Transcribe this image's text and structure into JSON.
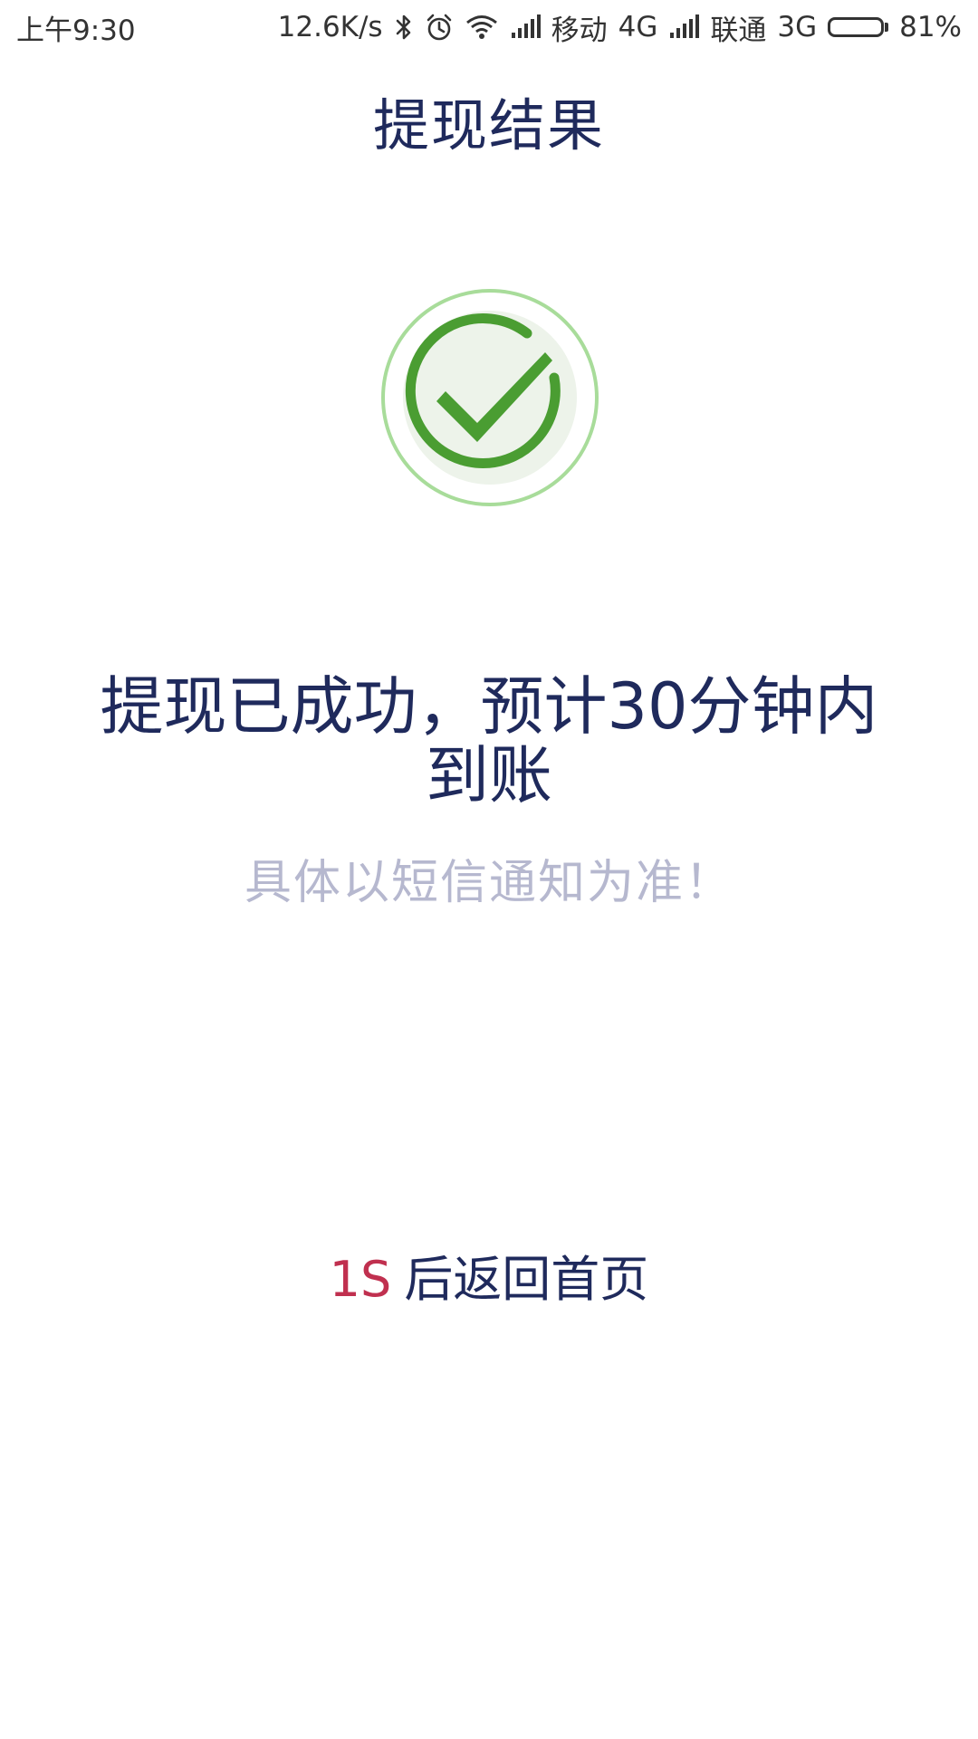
{
  "status_bar": {
    "time": "上午9:30",
    "net_speed": "12.6K/s",
    "carrier1": "移动",
    "carrier1_net": "4G",
    "carrier2": "联通",
    "carrier2_net": "3G",
    "battery_percent": "81%",
    "battery_level": 0.81,
    "icons": [
      "bluetooth-icon",
      "alarm-icon",
      "wifi-icon",
      "signal-icon",
      "signal-icon",
      "battery-icon"
    ]
  },
  "header": {
    "title": "提现结果"
  },
  "result": {
    "icon": "success-check-icon",
    "icon_colors": {
      "ring": "#4a9d32",
      "outer_ring": "#a8dc9a",
      "fill": "#edf3ea"
    },
    "message": "提现已成功，预计30分钟内到账",
    "note": "具体以短信通知为准！"
  },
  "countdown": {
    "seconds": "1S",
    "text": "后返回首页",
    "seconds_color": "#c0304f"
  },
  "colors": {
    "primary_text": "#1f2a5c",
    "secondary_text": "#b6b8cf"
  }
}
